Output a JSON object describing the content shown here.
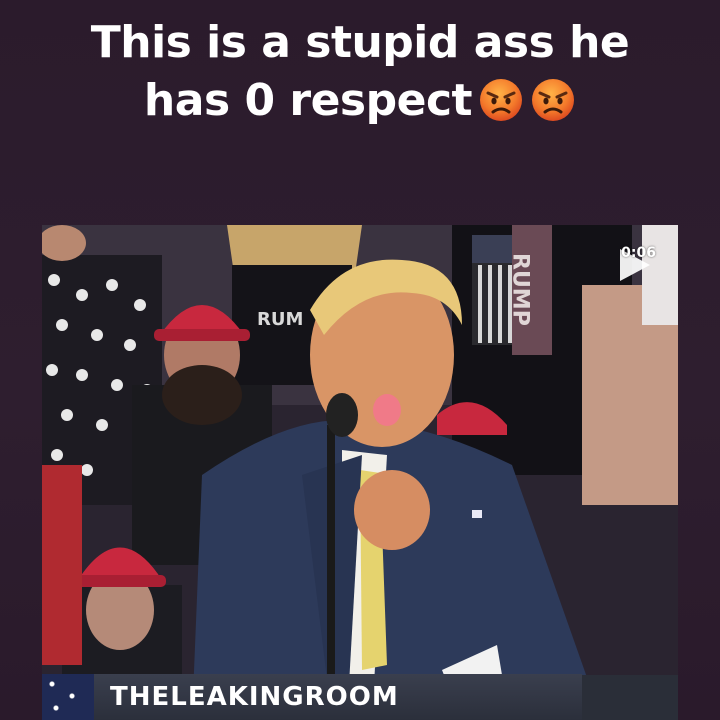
{
  "caption": {
    "line1": "This is a stupid ass he",
    "line2": "has 0 respect",
    "emojis": [
      "angry-face-emoji",
      "angry-face-emoji"
    ]
  },
  "video": {
    "timer": "0:06",
    "watermark": "THELEAKINGROOM",
    "sign_text": "RUMP",
    "shirt_text": "RUM",
    "play_icon": "play-icon"
  },
  "colors": {
    "background": "#2c1d2d",
    "caption_text": "#ffffff",
    "emoji_face": "#f0622a",
    "hat_red": "#c8283e",
    "suit_navy": "#2d3a5a",
    "tie_yellow": "#e5d36e"
  }
}
